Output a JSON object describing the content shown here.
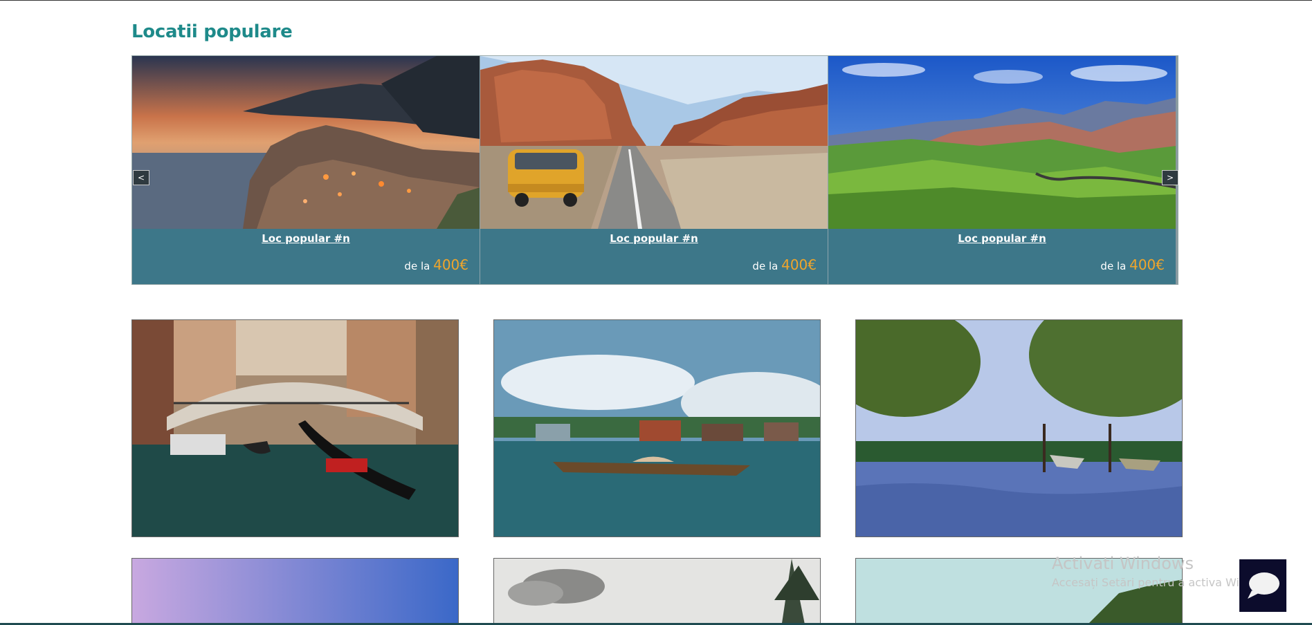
{
  "section": {
    "title": "Locatii populare"
  },
  "carousel": {
    "prev_label": "<",
    "next_label": ">",
    "cards": [
      {
        "title": "Loc popular #n",
        "price_prefix": "de la",
        "price": "400€",
        "image": "coastal-village-sunset"
      },
      {
        "title": "Loc popular #n",
        "price_prefix": "de la",
        "price": "400€",
        "image": "desert-road-van"
      },
      {
        "title": "Loc popular #n",
        "price_prefix": "de la",
        "price": "400€",
        "image": "green-valley-mountains"
      }
    ]
  },
  "grid": {
    "tiles": [
      {
        "image": "venice-canal-gondola"
      },
      {
        "image": "lake-village-boat"
      },
      {
        "image": "flooded-lake-boats"
      },
      {
        "image": "purple-sky"
      },
      {
        "image": "cloudy-sky-tree"
      },
      {
        "image": "teal-sky-foliage"
      }
    ]
  },
  "watermark": {
    "line1": "Activati Windows",
    "line2": "Accesați Setări pentru a activa Windows."
  },
  "colors": {
    "title": "#1e8a8a",
    "card_band": "#3d7789",
    "price": "#f0a52b"
  }
}
